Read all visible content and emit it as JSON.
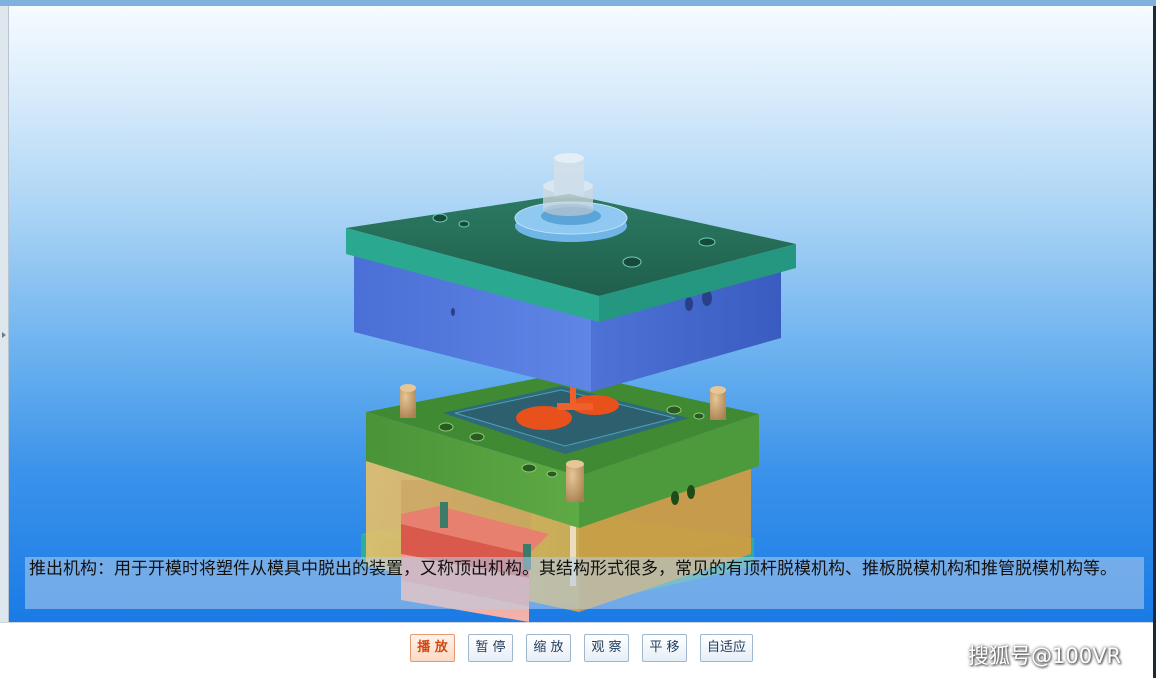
{
  "viewer": {
    "caption": "推出机构：用于开模时将塑件从模具中脱出的装置，又称顶出机构。其结构形式很多，常见的有顶杆脱模机构、推板脱模机构和推管脱模机构等。"
  },
  "toolbar": {
    "buttons": [
      {
        "label": "播 放",
        "active": true
      },
      {
        "label": "暂 停",
        "active": false
      },
      {
        "label": "缩 放",
        "active": false
      },
      {
        "label": "观 察",
        "active": false
      },
      {
        "label": "平 移",
        "active": false
      },
      {
        "label": "自适应",
        "active": false
      }
    ]
  },
  "watermark": {
    "text": "搜狐号@100VR"
  },
  "colors": {
    "top_plate": "#2aa890",
    "cavity_plate": "#4e72d6",
    "core_plate": "#4f9a3a",
    "spacer_block": "#e2b85c",
    "ejector_plate": "#d95a4c",
    "guide_pin": "#c9a070",
    "part": "#e8501c",
    "sprue_bushing": "#8fc8f0"
  }
}
